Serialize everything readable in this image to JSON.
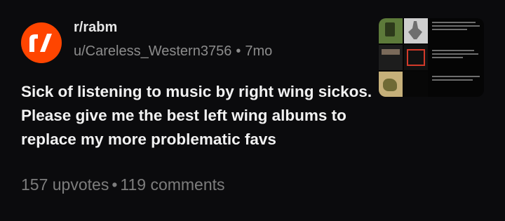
{
  "post": {
    "subreddit": "r/rabm",
    "author": "u/Careless_Western3756",
    "separator": "•",
    "age": "7mo",
    "title": "Sick of listening to music by right wing sickos. Please give me the best left wing albums to replace my more problematic favs",
    "upvotes": "157 upvotes",
    "comments": "119 comments"
  },
  "icons": {
    "avatar": "reddit-r-slash-icon",
    "thumbnail": "album-collage-thumbnail"
  },
  "colors": {
    "background": "#0b0b0d",
    "avatar": "#ff4500",
    "meta": "#8c8c8c",
    "stats": "#7d7d7d"
  }
}
